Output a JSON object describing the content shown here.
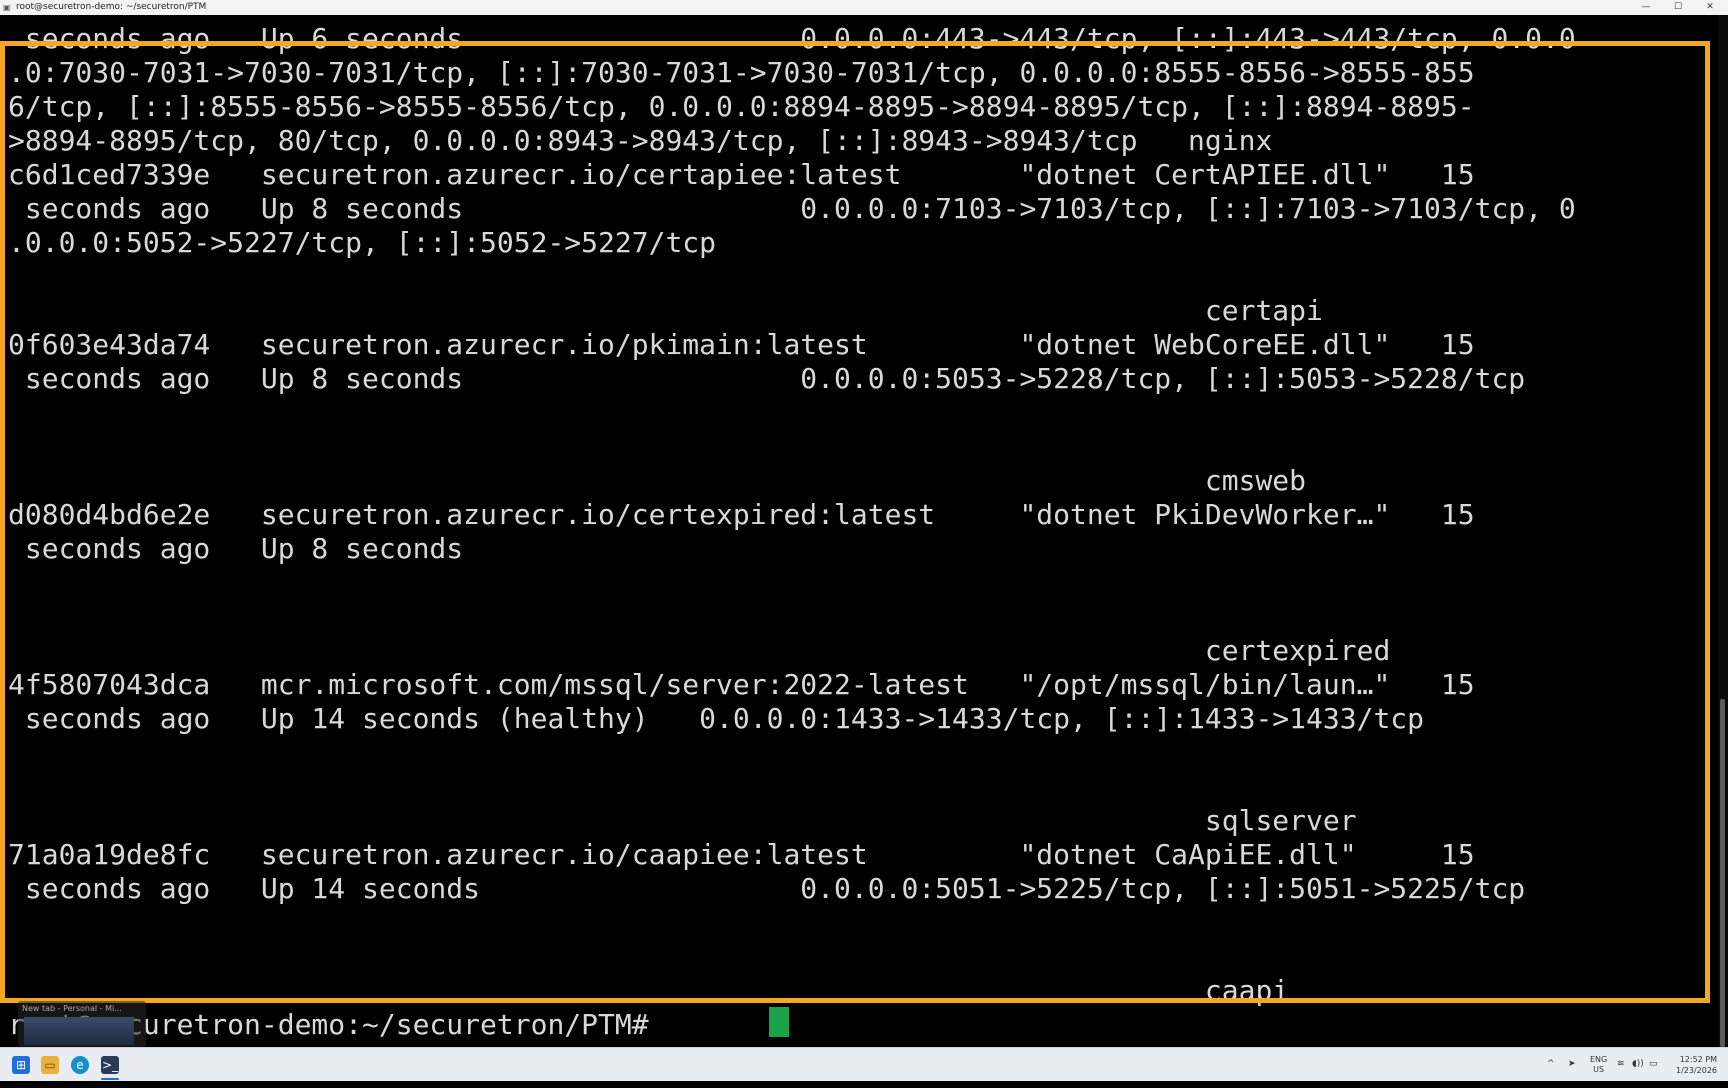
{
  "window": {
    "title": "root@securetron-demo: ~/securetron/PTM",
    "minimize_glyph": "—",
    "maximize_glyph": "☐",
    "close_glyph": "✕",
    "icon": "terminal-icon"
  },
  "terminal": {
    "lines": [
      " seconds ago   Up 6 seconds                    0.0.0.0:443->443/tcp, [::]:443->443/tcp, 0.0.0",
      ".0:7030-7031->7030-7031/tcp, [::]:7030-7031->7030-7031/tcp, 0.0.0.0:8555-8556->8555-855",
      "6/tcp, [::]:8555-8556->8555-8556/tcp, 0.0.0.0:8894-8895->8894-8895/tcp, [::]:8894-8895-",
      ">8894-8895/tcp, 80/tcp, 0.0.0.0:8943->8943/tcp, [::]:8943->8943/tcp   nginx",
      "c6d1ced7339e   securetron.azurecr.io/certapiee:latest       \"dotnet CertAPIEE.dll\"   15",
      " seconds ago   Up 8 seconds                    0.0.0.0:7103->7103/tcp, [::]:7103->7103/tcp, 0",
      ".0.0.0:5052->5227/tcp, [::]:5052->5227/tcp",
      "",
      "                                                                       certapi",
      "0f603e43da74   securetron.azurecr.io/pkimain:latest         \"dotnet WebCoreEE.dll\"   15",
      " seconds ago   Up 8 seconds                    0.0.0.0:5053->5228/tcp, [::]:5053->5228/tcp",
      "",
      "",
      "                                                                       cmsweb",
      "d080d4bd6e2e   securetron.azurecr.io/certexpired:latest     \"dotnet PkiDevWorker…\"   15",
      " seconds ago   Up 8 seconds",
      "",
      "",
      "                                                                       certexpired",
      "4f5807043dca   mcr.microsoft.com/mssql/server:2022-latest   \"/opt/mssql/bin/laun…\"   15",
      " seconds ago   Up 14 seconds (healthy)   0.0.0.0:1433->1433/tcp, [::]:1433->1433/tcp",
      "",
      "",
      "                                                                       sqlserver",
      "71a0a19de8fc   securetron.azurecr.io/caapiee:latest         \"dotnet CaApiEE.dll\"     15",
      " seconds ago   Up 14 seconds                   0.0.0.0:5051->5225/tcp, [::]:5051->5225/tcp",
      "",
      "",
      "                                                                       caapi",
      "root@securetron-demo:~/securetron/PTM# "
    ],
    "cursor_color": "#1aa34a",
    "highlight_color": "#f5a623"
  },
  "thumbnail": {
    "label": "New tab - Personal - Mi..."
  },
  "taskbar": {
    "start_icon": "windows-start-icon",
    "explorer_icon": "file-explorer-icon",
    "edge_icon": "edge-browser-icon",
    "terminal_icon": "terminal-app-icon",
    "tray_chevron": "^",
    "lang_line1": "ENG",
    "lang_line2": "US",
    "clock_time": "12:52 PM",
    "clock_date": "1/23/2026"
  }
}
